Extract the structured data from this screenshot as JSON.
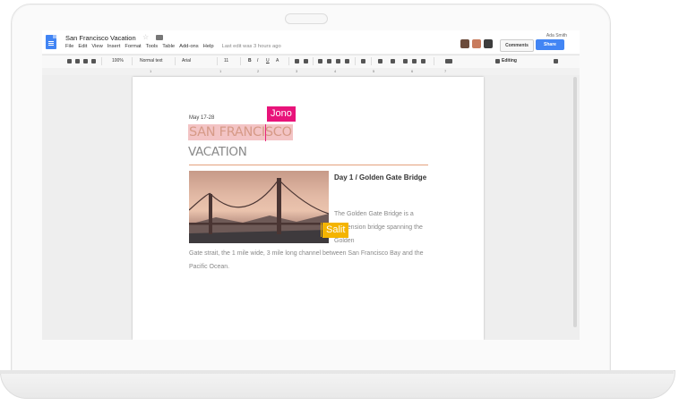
{
  "document": {
    "title": "San Francisco Vacation",
    "last_edit": "Last edit was 3 hours ago"
  },
  "menu": [
    "File",
    "Edit",
    "View",
    "Insert",
    "Format",
    "Tools",
    "Table",
    "Add-ons",
    "Help"
  ],
  "header": {
    "user_name": "Ada Smith",
    "comments_label": "Comments",
    "share_label": "Share"
  },
  "toolbar": {
    "zoom": "100%",
    "style": "Normal text",
    "font": "Arial",
    "font_size": "11",
    "bold": "B",
    "italic": "I",
    "underline": "U",
    "text_color": "A",
    "mode": "Editing"
  },
  "ruler": [
    "1",
    "1",
    "2",
    "3",
    "4",
    "5",
    "6",
    "7"
  ],
  "page": {
    "date_range": "May 17-28",
    "heading_1": "SAN FRANCISCO",
    "heading_2": "VACATION",
    "day_title": "Day 1 / Golden Gate Bridge",
    "day_body_first": "The Golden Gate Bridge is a suspension bridge spanning the Golden",
    "day_body_rest": "Gate strait, the 1 mile wide, 3 mile long channel between San Francisco Bay and the Pacific Ocean."
  },
  "collaborators": {
    "jono": "Jono",
    "salit": "Salit"
  },
  "colors": {
    "brand_blue": "#4285f4",
    "jono_flag": "#e8137a",
    "salit_flag": "#f4b400",
    "heading_highlight": "#f3c4c5",
    "divider": "#e4a27d"
  },
  "icons": [
    "docs-logo-icon",
    "star-icon",
    "folder-icon",
    "print-icon",
    "undo-icon",
    "redo-icon",
    "paint-format-icon",
    "link-icon",
    "comment-icon",
    "align-left-icon",
    "align-center-icon",
    "align-right-icon",
    "justify-icon",
    "line-spacing-icon",
    "numbered-list-icon",
    "bulleted-list-icon",
    "decrease-indent-icon",
    "increase-indent-icon",
    "clear-formatting-icon",
    "input-tools-icon",
    "pencil-icon",
    "collapse-icon"
  ]
}
